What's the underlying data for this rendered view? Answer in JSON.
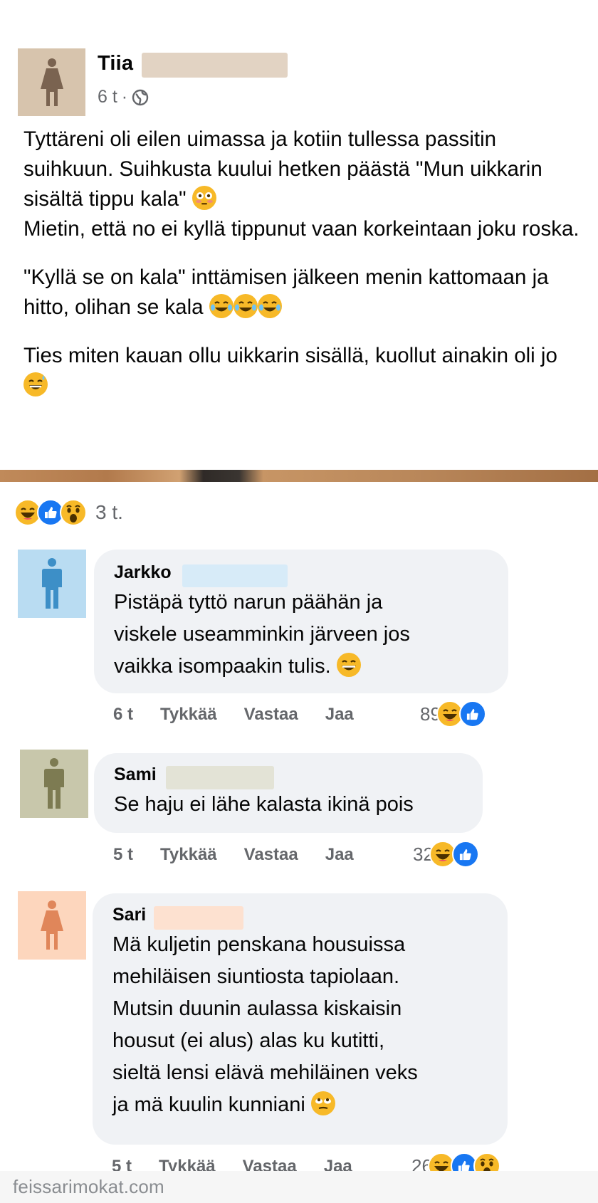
{
  "post": {
    "author": "Tiia",
    "time": "6 t",
    "separator": "·",
    "paragraphs": [
      "Tyttäreni oli eilen uimassa ja kotiin tullessa passitin suihkuun. Suihkusta kuului hetken päästä \"Mun uikkarin sisältä tippu kala\"",
      "Mietin, että no ei kyllä tippunut vaan korkeintaan joku roska.",
      "\"Kyllä se on kala\" inttämisen jälkeen menin kattomaan ja hitto, olihan se kala",
      "Ties miten kauan ollu uikkarin sisällä, kuollut ainakin oli jo"
    ]
  },
  "reactions": {
    "icons": [
      "laugh-icon",
      "like-icon",
      "wow-icon"
    ],
    "count": "3 t."
  },
  "comments": [
    {
      "author": "Jarkko",
      "lines": [
        "Pistäpä tyttö narun päähän ja",
        "viskele useamminkin järveen jos",
        "vaikka isompaakin tulis."
      ],
      "time": "6 t",
      "like": "Tykkää",
      "reply": "Vastaa",
      "share": "Jaa",
      "reaction_count": "89",
      "reaction_icons": [
        "laugh-icon",
        "like-icon"
      ]
    },
    {
      "author": "Sami",
      "lines": [
        "Se haju ei lähe kalasta ikinä pois"
      ],
      "time": "5 t",
      "like": "Tykkää",
      "reply": "Vastaa",
      "share": "Jaa",
      "reaction_count": "32",
      "reaction_icons": [
        "laugh-icon",
        "like-icon"
      ]
    },
    {
      "author": "Sari",
      "lines": [
        "Mä kuljetin penskana housuissa",
        "mehiläisen siuntiosta tapiolaan.",
        "Mutsin duunin aulassa kiskaisin",
        "housut (ei alus) alas ku kutitti,",
        "sieltä lensi elävä mehiläinen veks",
        "ja mä kuulin kunniani"
      ],
      "time": "5 t",
      "like": "Tykkää",
      "reply": "Vastaa",
      "share": "Jaa",
      "reaction_count": "26",
      "reaction_icons": [
        "laugh-icon",
        "like-icon",
        "wow-icon"
      ]
    }
  ],
  "watermark": "feissarimokat.com",
  "colors": {
    "post_avatar_bg": "#d7c4ad",
    "post_avatar_fg": "#7a6350",
    "jarkko_avatar_bg": "#b9dcf2",
    "jarkko_avatar_fg": "#3d8fc7",
    "sami_avatar_bg": "#c8c7ab",
    "sami_avatar_fg": "#7d7b52",
    "sari_avatar_bg": "#fdd6bd",
    "sari_avatar_fg": "#e0865a",
    "like_blue": "#1877f2",
    "emoji_yellow": "#f7b928"
  }
}
